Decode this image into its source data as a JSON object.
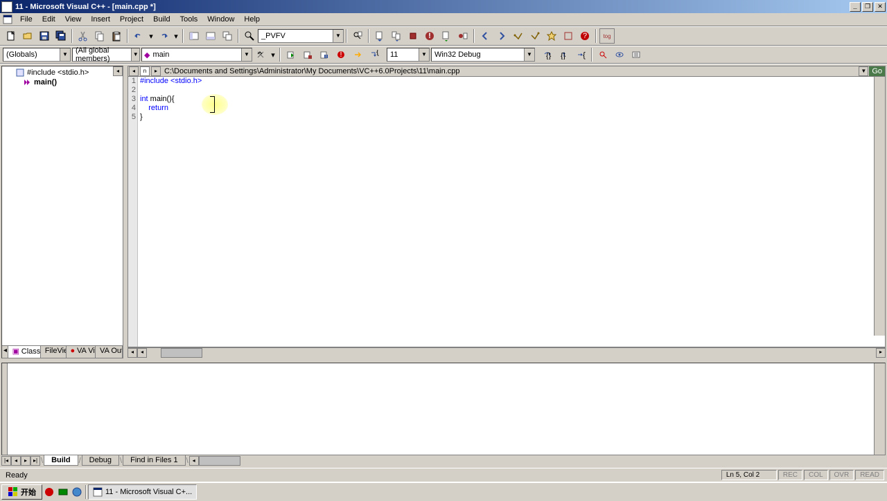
{
  "window": {
    "title": "11 - Microsoft Visual C++ - [main.cpp *]"
  },
  "menu": {
    "file": "File",
    "edit": "Edit",
    "view": "View",
    "insert": "Insert",
    "project": "Project",
    "build": "Build",
    "tools": "Tools",
    "window": "Window",
    "help": "Help"
  },
  "toolbar1": {
    "combo_find": "_PVFV"
  },
  "wizardbar": {
    "class_combo": "(Globals)",
    "filter_combo": "(All global members)",
    "member_combo": "main",
    "config_combo1": "11",
    "config_combo2": "Win32 Debug"
  },
  "sidebar": {
    "items": [
      {
        "label": "#include <stdio.h>",
        "icon": "include-icon"
      },
      {
        "label": "main()",
        "icon": "function-icon"
      }
    ],
    "tabs": {
      "classview": "ClassV",
      "fileview": "FileVie",
      "vaview": "VA Vie",
      "vaoutline": "VA Outl"
    }
  },
  "editor": {
    "filepath": "C:\\Documents and Settings\\Administrator\\My Documents\\VC++6.0Projects\\11\\main.cpp",
    "go_label": "Go",
    "lines": {
      "l1_pp": "#include ",
      "l1_hdr": "<stdio.h>",
      "l2": "",
      "l3_t1": "int",
      "l3_t2": " main(){",
      "l4_indent": "    ",
      "l4_kw": "return",
      "l5": "}"
    },
    "line_numbers": [
      "1",
      "2",
      "3",
      "4",
      "5"
    ]
  },
  "output": {
    "tabs": {
      "build": "Build",
      "debug": "Debug",
      "findinfiles1": "Find in Files 1"
    }
  },
  "status": {
    "ready": "Ready",
    "position": "Ln 5, Col 2",
    "rec": "REC",
    "col": "COL",
    "ovr": "OVR",
    "read": "READ"
  },
  "taskbar": {
    "start": "开始",
    "task1": "11 - Microsoft Visual C+..."
  }
}
